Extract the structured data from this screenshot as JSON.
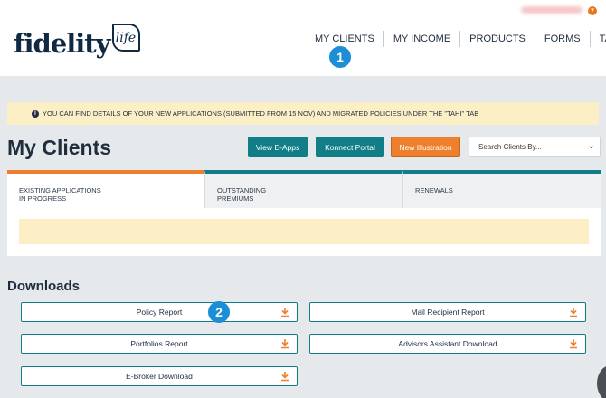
{
  "header": {
    "logo_word": "fidelity",
    "logo_life": "life",
    "nav": [
      "MY CLIENTS",
      "MY INCOME",
      "PRODUCTS",
      "FORMS",
      "TAHI"
    ]
  },
  "badges": {
    "one": "1",
    "two": "2"
  },
  "notice": {
    "text": "YOU CAN FIND DETAILS OF YOUR NEW APPLICATIONS (SUBMITTED FROM 15 NOV) AND MIGRATED POLICIES UNDER THE \"TAHI\" TAB",
    "icon": "info-icon"
  },
  "page": {
    "title": "My Clients"
  },
  "actions": {
    "view_eapps": "View E-Apps",
    "konnect": "Konnect Portal",
    "new_illustration": "New Illustration",
    "search_placeholder": "Search Clients By..."
  },
  "tabs": [
    {
      "line1": "EXISTING APPLICATIONS",
      "line2": "IN PROGRESS"
    },
    {
      "line1": "OUTSTANDING",
      "line2": "PREMIUMS"
    },
    {
      "line1": "RENEWALS",
      "line2": ""
    }
  ],
  "downloads": {
    "title": "Downloads",
    "items": [
      "Policy Report",
      "Mail Recipient Report",
      "Portfolios Report",
      "Advisors Assistant Download",
      "E-Broker Download"
    ]
  },
  "colors": {
    "teal": "#117e87",
    "orange": "#ee7f2d",
    "notice": "#fcefc6",
    "badge": "#1b8ed6"
  }
}
